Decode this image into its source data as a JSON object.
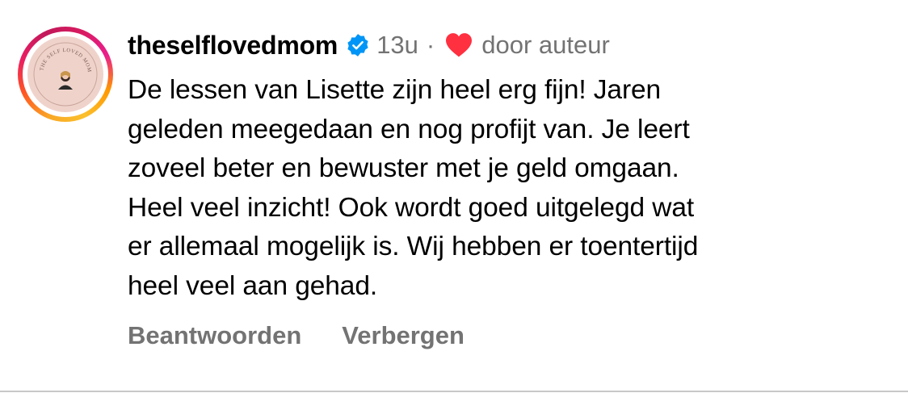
{
  "comment": {
    "author": {
      "username": "theselflovedmom",
      "verified": true,
      "avatar_icon": "profile-avatar",
      "avatar_logo_text": "THE SELF LOVED MOM"
    },
    "timestamp": "13u",
    "separator": "·",
    "liked_by_author_icon": "heart-icon",
    "liked_by_author_color": "#ff3040",
    "liked_by_author_label": "door auteur",
    "text": "De lessen van Lisette zijn heel erg fijn! Jaren\ngeleden meegedaan en nog profijt van. Je leert\nzoveel beter en bewuster met je geld omgaan.\nHeel veel inzicht! Ook wordt goed uitgelegd wat\ner allemaal mogelijk is. Wij hebben er toentertijd\nheel veel aan gehad."
  },
  "actions": {
    "reply_label": "Beantwoorden",
    "hide_label": "Verbergen"
  },
  "colors": {
    "verified_blue": "#0095f6",
    "secondary_text": "#737373"
  }
}
